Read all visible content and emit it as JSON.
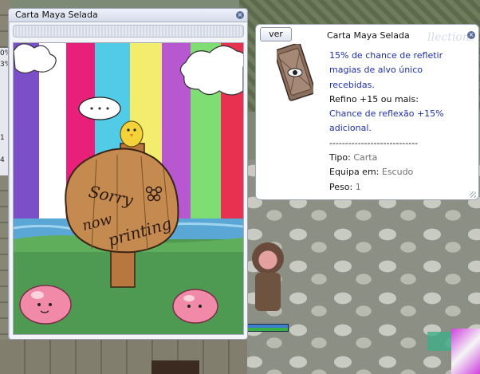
{
  "card_window": {
    "title": "Carta Maya Selada",
    "art_text": {
      "line1": "Sorry",
      "line2": "now",
      "line3": "printing"
    }
  },
  "description_window": {
    "ver_button": "ver",
    "card_name": "Carta Maya Selada",
    "watermark": "llections",
    "description_lines": [
      "15% de chance de refletir",
      "magias de alvo único",
      "recebidas.",
      "Refino +15 ou mais:",
      "Chance de reflexão +15%",
      "adicional."
    ],
    "separator": "----------------------------",
    "type_label": "Tipo:",
    "type_value": "Carta",
    "equip_label": "Equipa em:",
    "equip_value": "Escudo",
    "weight_label": "Peso:",
    "weight_value": "1"
  },
  "left_panel": {
    "items": [
      "0%",
      "3%",
      "1",
      "4"
    ]
  }
}
